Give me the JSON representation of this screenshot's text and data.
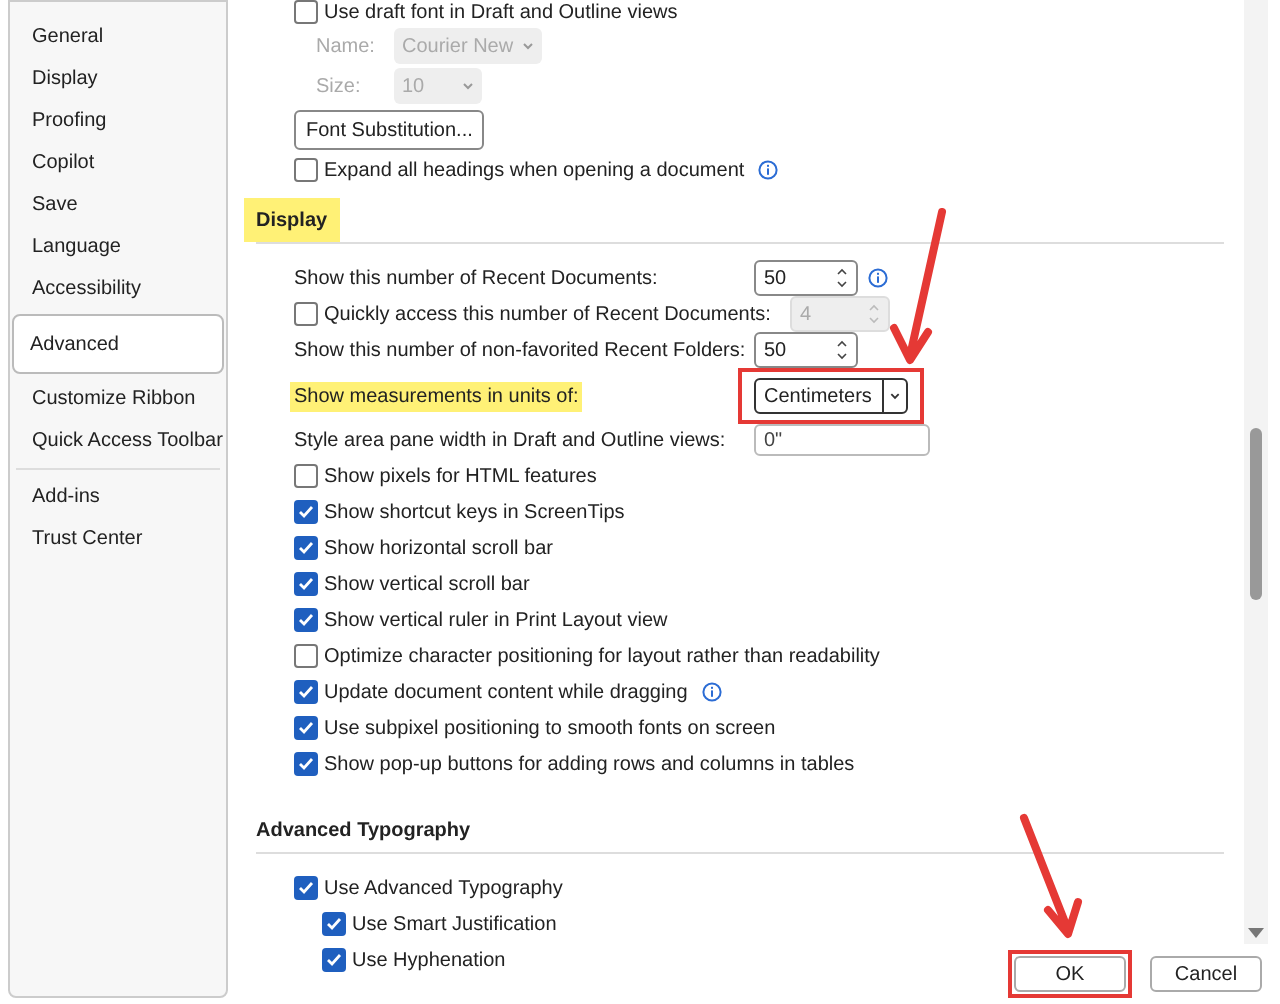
{
  "sidebar": {
    "groups": [
      [
        {
          "label": "General",
          "selected": false
        },
        {
          "label": "Display",
          "selected": false
        },
        {
          "label": "Proofing",
          "selected": false
        },
        {
          "label": "Copilot",
          "selected": false
        },
        {
          "label": "Save",
          "selected": false
        },
        {
          "label": "Language",
          "selected": false
        },
        {
          "label": "Accessibility",
          "selected": false
        },
        {
          "label": "Advanced",
          "selected": true
        },
        {
          "label": "Customize Ribbon",
          "selected": false
        },
        {
          "label": "Quick Access Toolbar",
          "selected": false
        }
      ],
      [
        {
          "label": "Add-ins",
          "selected": false
        },
        {
          "label": "Trust Center",
          "selected": false
        }
      ]
    ]
  },
  "font_section": {
    "draft_font": {
      "label": "Use draft font in Draft and Outline views",
      "checked": false
    },
    "name": {
      "label": "Name:",
      "value": "Courier New",
      "disabled": true
    },
    "size": {
      "label": "Size:",
      "value": "10",
      "disabled": true
    },
    "button": "Font Substitution...",
    "expand": {
      "label": "Expand all headings when opening a document",
      "checked": false,
      "info": true
    }
  },
  "sections": [
    {
      "title": "Display",
      "highlighted": true,
      "rows": [
        {
          "kind": "spinner",
          "label": "Show this number of Recent Documents:",
          "value": "50",
          "info": true
        },
        {
          "kind": "checkbox-spinner",
          "label": "Quickly access this number of Recent Documents:",
          "checked": false,
          "value": "4",
          "disabled": true
        },
        {
          "kind": "spinner",
          "label": "Show this number of non-favorited Recent Folders:",
          "value": "50",
          "info": false
        },
        {
          "kind": "dropdown",
          "label": "Show measurements in units of:",
          "value": "Centimeters",
          "highlighted": true,
          "annotated": true
        },
        {
          "kind": "text",
          "label": "Style area pane width in Draft and Outline views:",
          "value": "0\""
        },
        {
          "kind": "checkbox",
          "label": "Show pixels for HTML features",
          "checked": false,
          "info": false
        },
        {
          "kind": "checkbox",
          "label": "Show shortcut keys in ScreenTips",
          "checked": true,
          "info": false
        },
        {
          "kind": "checkbox",
          "label": "Show horizontal scroll bar",
          "checked": true,
          "info": false
        },
        {
          "kind": "checkbox",
          "label": "Show vertical scroll bar",
          "checked": true,
          "info": false
        },
        {
          "kind": "checkbox",
          "label": "Show vertical ruler in Print Layout view",
          "checked": true,
          "info": false
        },
        {
          "kind": "checkbox",
          "label": "Optimize character positioning for layout rather than readability",
          "checked": false,
          "info": false
        },
        {
          "kind": "checkbox",
          "label": "Update document content while dragging",
          "checked": true,
          "info": true
        },
        {
          "kind": "checkbox",
          "label": "Use subpixel positioning to smooth fonts on screen",
          "checked": true,
          "info": false
        },
        {
          "kind": "checkbox",
          "label": "Show pop-up buttons for adding rows and columns in tables",
          "checked": true,
          "info": false
        }
      ]
    },
    {
      "title": "Advanced Typography",
      "highlighted": false,
      "rows": [
        {
          "kind": "checkbox",
          "label": "Use Advanced Typography",
          "checked": true,
          "info": false,
          "children": [
            {
              "kind": "checkbox",
              "label": "Use Smart Justification",
              "checked": true,
              "info": false
            },
            {
              "kind": "checkbox",
              "label": "Use Hyphenation",
              "checked": true,
              "info": false
            }
          ]
        }
      ]
    }
  ],
  "buttons": [
    {
      "label": "OK",
      "annotated": true
    },
    {
      "label": "Cancel",
      "annotated": false
    }
  ]
}
